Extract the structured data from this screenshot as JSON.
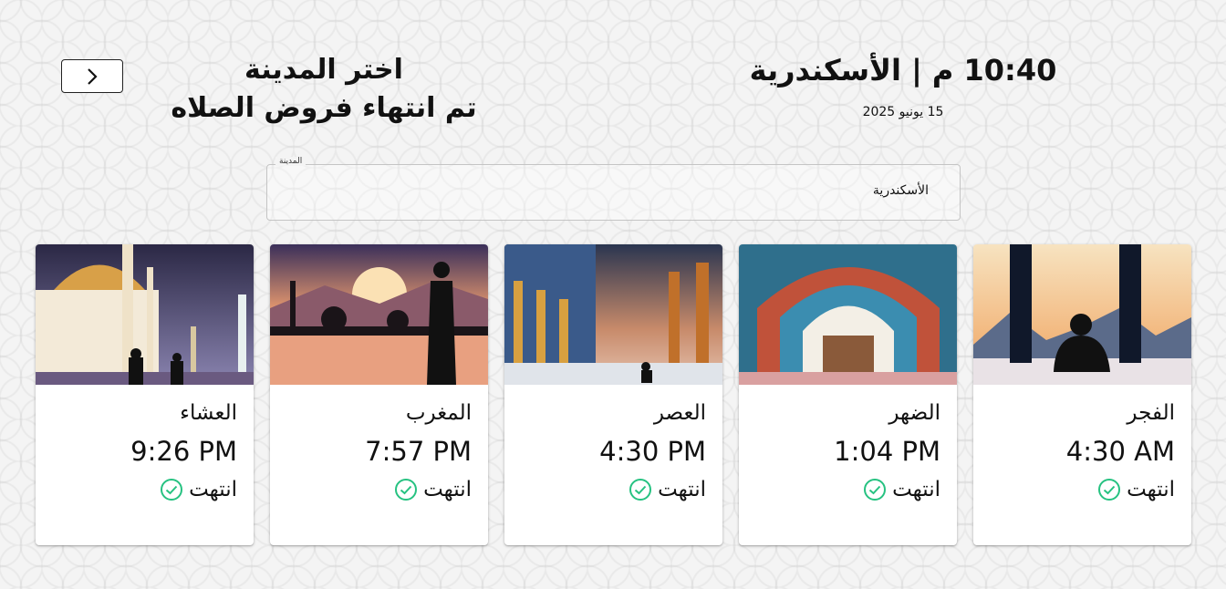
{
  "header": {
    "nav_button_icon": "chevron-right-icon",
    "choose_city_title": "اختر المدينة",
    "status_message": "تم انتهاء فروض الصلاه",
    "time_city": "10:40 م | الأسكندرية",
    "date": "15 يونيو 2025"
  },
  "city_select": {
    "label": "المدينة",
    "value": "الأسكندرية"
  },
  "colors": {
    "status_check": "#26c281",
    "card_bg": "#ffffff",
    "text": "#111111"
  },
  "prayers": [
    {
      "name": "الفجر",
      "time": "4:30 AM",
      "status": "انتهت",
      "status_icon": "check-circle-icon"
    },
    {
      "name": "الضهر",
      "time": "1:04 PM",
      "status": "انتهت",
      "status_icon": "check-circle-icon"
    },
    {
      "name": "العصر",
      "time": "4:30 PM",
      "status": "انتهت",
      "status_icon": "check-circle-icon"
    },
    {
      "name": "المغرب",
      "time": "7:57 PM",
      "status": "انتهت",
      "status_icon": "check-circle-icon"
    },
    {
      "name": "العشاء",
      "time": "9:26 PM",
      "status": "انتهت",
      "status_icon": "check-circle-icon"
    }
  ]
}
